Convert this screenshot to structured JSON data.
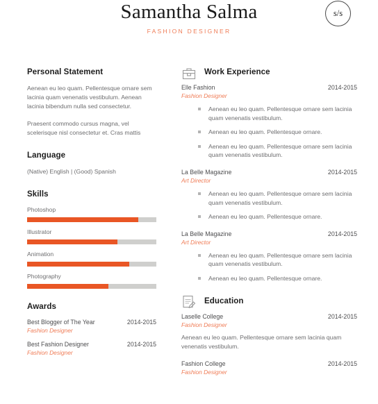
{
  "header": {
    "name": "Samantha Salma",
    "tagline": "FASHION DESIGNER",
    "monogram": "s/s",
    "accent": "#e95625",
    "accent_light": "#ef7b55"
  },
  "left": {
    "personal_statement": {
      "title": "Personal Statement",
      "paragraphs": [
        "Aenean eu leo quam. Pellentesque ornare sem lacinia quam venenatis vestibulum. Aenean lacinia bibendum nulla sed consectetur.",
        "Praesent commodo cursus magna, vel scelerisque nisl consectetur et. Cras mattis"
      ]
    },
    "language": {
      "title": "Language",
      "value": "(Native) English  |  (Good) Spanish"
    },
    "skills": {
      "title": "Skills",
      "items": [
        {
          "label": "Photoshop",
          "percent": 86
        },
        {
          "label": "Illustrator",
          "percent": 70
        },
        {
          "label": "Animation",
          "percent": 79
        },
        {
          "label": "Photography",
          "percent": 63
        }
      ]
    },
    "awards": {
      "title": "Awards",
      "items": [
        {
          "title": "Best Blogger of The Year",
          "date": "2014-2015",
          "sub": "Fashion Designer"
        },
        {
          "title": "Best Fashion Designer",
          "date": "2014-2015",
          "sub": "Fashion Designer"
        }
      ]
    }
  },
  "right": {
    "work": {
      "title": "Work Experience",
      "icon": "briefcase-icon",
      "items": [
        {
          "title": "Elle Fashion",
          "date": "2014-2015",
          "sub": "Fashion Designer",
          "bullets": [
            "Aenean eu leo quam. Pellentesque ornare sem lacinia quam venenatis vestibulum.",
            "Aenean eu leo quam. Pellentesque ornare.",
            "Aenean eu leo quam. Pellentesque ornare sem lacinia quam venenatis vestibulum."
          ]
        },
        {
          "title": "La Belle Magazine",
          "date": "2014-2015",
          "sub": "Art Director",
          "bullets": [
            "Aenean eu leo quam. Pellentesque ornare sem lacinia quam venenatis vestibulum.",
            "Aenean eu leo quam. Pellentesque ornare."
          ]
        },
        {
          "title": "La Belle Magazine",
          "date": "2014-2015",
          "sub": "Art Director",
          "bullets": [
            "Aenean eu leo quam. Pellentesque ornare sem lacinia quam venenatis vestibulum.",
            "Aenean eu leo quam. Pellentesque ornare."
          ]
        }
      ]
    },
    "education": {
      "title": "Education",
      "icon": "document-pen-icon",
      "items": [
        {
          "title": "Laselle College",
          "date": "2014-2015",
          "sub": "Fashion Designer",
          "desc": "Aenean eu leo quam. Pellentesque ornare sem lacinia quam venenatis vestibulum."
        },
        {
          "title": "Fashion College",
          "date": "2014-2015",
          "sub": "Fashion Designer",
          "desc": ""
        }
      ]
    }
  }
}
